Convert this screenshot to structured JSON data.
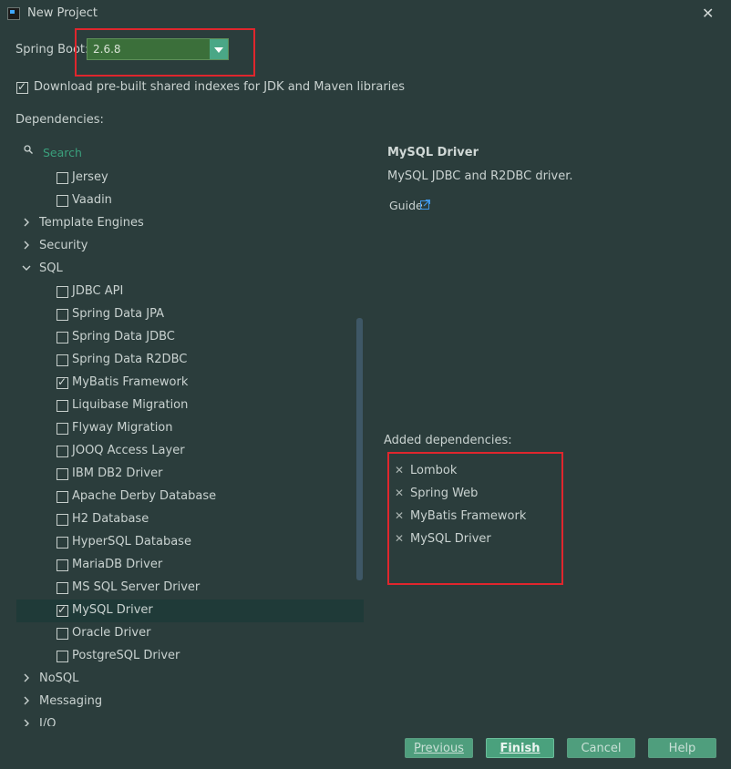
{
  "window": {
    "title": "New Project",
    "close_glyph": "✕"
  },
  "spring_boot": {
    "label": "Spring Boot:",
    "version": "2.6.8"
  },
  "download_option": {
    "checked": true,
    "label": "Download pre-built shared indexes for JDK and Maven libraries"
  },
  "dependencies": {
    "label": "Dependencies:",
    "search_placeholder": "Search",
    "tree": [
      {
        "type": "item",
        "label": "Jersey",
        "checked": false
      },
      {
        "type": "item",
        "label": "Vaadin",
        "checked": false
      },
      {
        "type": "group",
        "label": "Template Engines",
        "expanded": false
      },
      {
        "type": "group",
        "label": "Security",
        "expanded": false
      },
      {
        "type": "group",
        "label": "SQL",
        "expanded": true
      },
      {
        "type": "item",
        "label": "JDBC API",
        "checked": false
      },
      {
        "type": "item",
        "label": "Spring Data JPA",
        "checked": false
      },
      {
        "type": "item",
        "label": "Spring Data JDBC",
        "checked": false
      },
      {
        "type": "item",
        "label": "Spring Data R2DBC",
        "checked": false
      },
      {
        "type": "item",
        "label": "MyBatis Framework",
        "checked": true
      },
      {
        "type": "item",
        "label": "Liquibase Migration",
        "checked": false
      },
      {
        "type": "item",
        "label": "Flyway Migration",
        "checked": false
      },
      {
        "type": "item",
        "label": "JOOQ Access Layer",
        "checked": false
      },
      {
        "type": "item",
        "label": "IBM DB2 Driver",
        "checked": false
      },
      {
        "type": "item",
        "label": "Apache Derby Database",
        "checked": false
      },
      {
        "type": "item",
        "label": "H2 Database",
        "checked": false
      },
      {
        "type": "item",
        "label": "HyperSQL Database",
        "checked": false
      },
      {
        "type": "item",
        "label": "MariaDB Driver",
        "checked": false
      },
      {
        "type": "item",
        "label": "MS SQL Server Driver",
        "checked": false
      },
      {
        "type": "item",
        "label": "MySQL Driver",
        "checked": true,
        "selected": true
      },
      {
        "type": "item",
        "label": "Oracle Driver",
        "checked": false
      },
      {
        "type": "item",
        "label": "PostgreSQL Driver",
        "checked": false
      },
      {
        "type": "group",
        "label": "NoSQL",
        "expanded": false
      },
      {
        "type": "group",
        "label": "Messaging",
        "expanded": false
      },
      {
        "type": "group",
        "label": "I/O",
        "expanded": false
      }
    ]
  },
  "details": {
    "title": "MySQL Driver",
    "description": "MySQL JDBC and R2DBC driver.",
    "guide_label": "Guide"
  },
  "added_dependencies": {
    "label": "Added dependencies:",
    "items": [
      "Lombok",
      "Spring Web",
      "MyBatis Framework",
      "MySQL Driver"
    ]
  },
  "buttons": {
    "previous": "Previous",
    "finish": "Finish",
    "cancel": "Cancel",
    "help": "Help"
  },
  "colors": {
    "background": "#2b3d3c",
    "accent": "#4aa17d",
    "highlight_box": "#e0262d",
    "selected_row": "#1f3a38",
    "search_text": "#3aa07c"
  },
  "icons": {
    "app": "app-icon",
    "search": "search-icon",
    "expand": "chevron-right-icon",
    "collapse": "chevron-down-icon",
    "external_link": "external-link-icon",
    "remove": "remove-icon"
  }
}
